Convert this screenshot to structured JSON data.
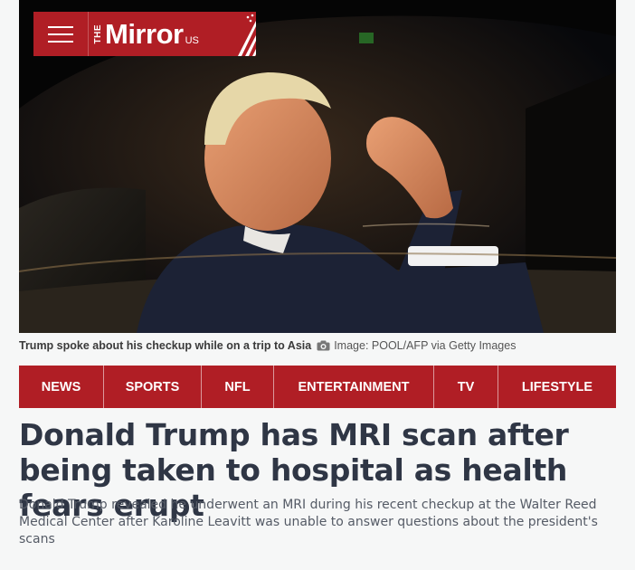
{
  "masthead": {
    "logo_the": "THE",
    "logo_name": "Mirror",
    "logo_edition": "US",
    "brand_color": "#b01e25"
  },
  "hero": {
    "icon": "photo"
  },
  "caption": {
    "text": "Trump spoke about his checkup while on a trip to Asia",
    "camera_icon": "camera-icon",
    "credit": "Image: POOL/AFP via Getty Images"
  },
  "nav": {
    "items": [
      {
        "label": "NEWS"
      },
      {
        "label": "SPORTS"
      },
      {
        "label": "NFL"
      },
      {
        "label": "ENTERTAINMENT"
      },
      {
        "label": "TV"
      },
      {
        "label": "LIFESTYLE"
      }
    ]
  },
  "article": {
    "headline": "Donald Trump has MRI scan after being taken to hospital as health fears erupt",
    "standfirst": "Donald Trump revealed he underwent an MRI during his recent checkup at the Walter Reed Medical Center after Karoline Leavitt was unable to answer questions about the president's scans"
  }
}
